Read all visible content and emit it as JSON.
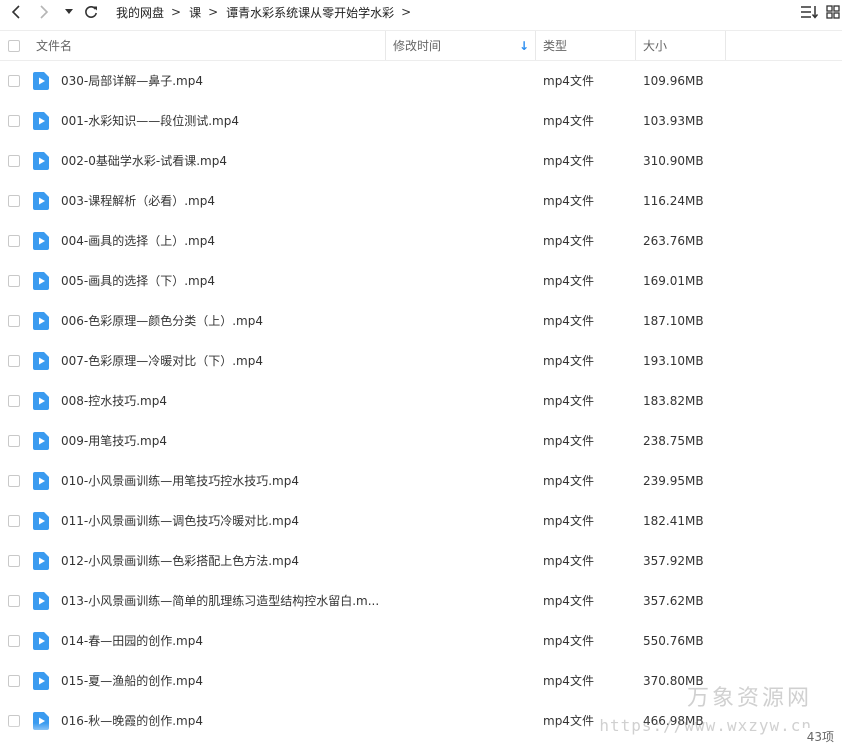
{
  "breadcrumb": [
    "我的网盘",
    "课",
    "谭青水彩系统课从零开始学水彩"
  ],
  "columns": {
    "name": "文件名",
    "modified": "修改时间",
    "type": "类型",
    "size": "大小"
  },
  "sort_indicator": "↓",
  "colors": {
    "file_icon": "#3a9bf0",
    "sort_arrow": "#2b8ef0"
  },
  "files": [
    {
      "name": "030-局部详解—鼻子.mp4",
      "type": "mp4文件",
      "size": "109.96MB"
    },
    {
      "name": "001-水彩知识——段位测试.mp4",
      "type": "mp4文件",
      "size": "103.93MB"
    },
    {
      "name": "002-0基础学水彩-试看课.mp4",
      "type": "mp4文件",
      "size": "310.90MB"
    },
    {
      "name": "003-课程解析（必看）.mp4",
      "type": "mp4文件",
      "size": "116.24MB"
    },
    {
      "name": "004-画具的选择（上）.mp4",
      "type": "mp4文件",
      "size": "263.76MB"
    },
    {
      "name": "005-画具的选择（下）.mp4",
      "type": "mp4文件",
      "size": "169.01MB"
    },
    {
      "name": "006-色彩原理—颜色分类（上）.mp4",
      "type": "mp4文件",
      "size": "187.10MB"
    },
    {
      "name": "007-色彩原理—冷暖对比（下）.mp4",
      "type": "mp4文件",
      "size": "193.10MB"
    },
    {
      "name": "008-控水技巧.mp4",
      "type": "mp4文件",
      "size": "183.82MB"
    },
    {
      "name": "009-用笔技巧.mp4",
      "type": "mp4文件",
      "size": "238.75MB"
    },
    {
      "name": "010-小风景画训练—用笔技巧控水技巧.mp4",
      "type": "mp4文件",
      "size": "239.95MB"
    },
    {
      "name": "011-小风景画训练—调色技巧冷暖对比.mp4",
      "type": "mp4文件",
      "size": "182.41MB"
    },
    {
      "name": "012-小风景画训练—色彩搭配上色方法.mp4",
      "type": "mp4文件",
      "size": "357.92MB"
    },
    {
      "name": "013-小风景画训练—简单的肌理练习造型结构控水留白.m...",
      "type": "mp4文件",
      "size": "357.62MB"
    },
    {
      "name": "014-春—田园的创作.mp4",
      "type": "mp4文件",
      "size": "550.76MB"
    },
    {
      "name": "015-夏—渔船的创作.mp4",
      "type": "mp4文件",
      "size": "370.80MB"
    },
    {
      "name": "016-秋—晚霞的创作.mp4",
      "type": "mp4文件",
      "size": "466.98MB"
    }
  ],
  "item_count": "43项",
  "watermark": {
    "name": "万象资源网",
    "url": "https://www.wxzyw.cn"
  }
}
